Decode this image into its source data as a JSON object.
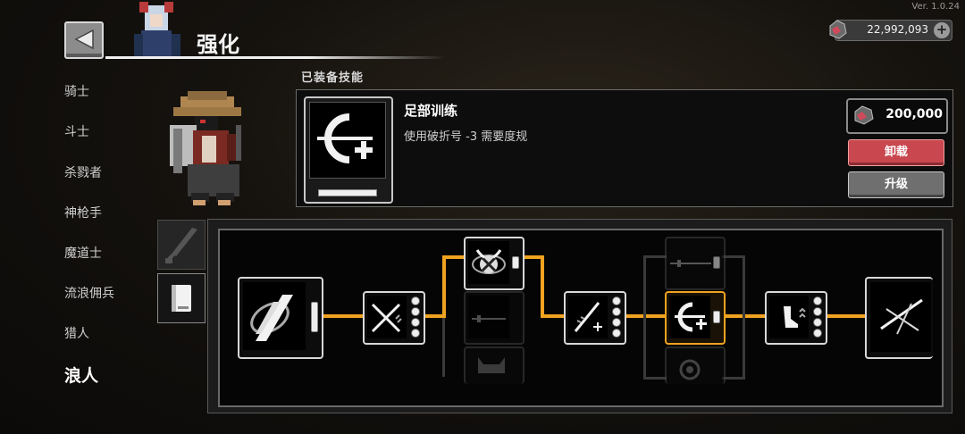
{
  "version": "Ver. 1.0.24",
  "header": {
    "title": "强化"
  },
  "currency": {
    "amount": "22,992,093",
    "plus": "+"
  },
  "classes": [
    {
      "label": "骑士",
      "active": false
    },
    {
      "label": "斗士",
      "active": false
    },
    {
      "label": "杀戮者",
      "active": false
    },
    {
      "label": "神枪手",
      "active": false
    },
    {
      "label": "魔道士",
      "active": false
    },
    {
      "label": "流浪佣兵",
      "active": false
    },
    {
      "label": "猎人",
      "active": false
    },
    {
      "label": "浪人",
      "active": true
    }
  ],
  "section_label": "已装备技能",
  "skill": {
    "name": "足部训练",
    "description": "使用破折号 -3 需要度规",
    "cost": "200,000",
    "unload_label": "卸载",
    "upgrade_label": "升级"
  },
  "tabs": [
    {
      "name": "sword-tab",
      "icon": "sword-icon"
    },
    {
      "name": "book-tab",
      "icon": "book-icon",
      "active": true
    }
  ],
  "tree": {
    "nodes": [
      {
        "id": "root",
        "icon": "slash-emblem-icon",
        "state": "unlocked"
      },
      {
        "id": "crossed-swords",
        "icon": "crossed-swords-icon",
        "state": "unlocked"
      },
      {
        "id": "horned-mask",
        "icon": "horned-mask-icon",
        "state": "unlocked"
      },
      {
        "id": "sword-line",
        "icon": "sword-icon",
        "state": "locked"
      },
      {
        "id": "demon-helm",
        "icon": "helm-icon",
        "state": "locked"
      },
      {
        "id": "blade-plus",
        "icon": "blade-plus-icon",
        "state": "unlocked"
      },
      {
        "id": "long-sword",
        "icon": "long-sword-icon",
        "state": "locked"
      },
      {
        "id": "foot-training",
        "icon": "dash-plus-icon",
        "state": "selected"
      },
      {
        "id": "ring",
        "icon": "ring-icon",
        "state": "locked"
      },
      {
        "id": "boot-up",
        "icon": "boot-icon",
        "state": "unlocked"
      },
      {
        "id": "final-slash",
        "icon": "x-slash-icon",
        "state": "unlocked"
      }
    ]
  },
  "colors": {
    "accent": "#f0a320",
    "unload": "#c9474f",
    "upgrade": "#6f6f6f"
  }
}
